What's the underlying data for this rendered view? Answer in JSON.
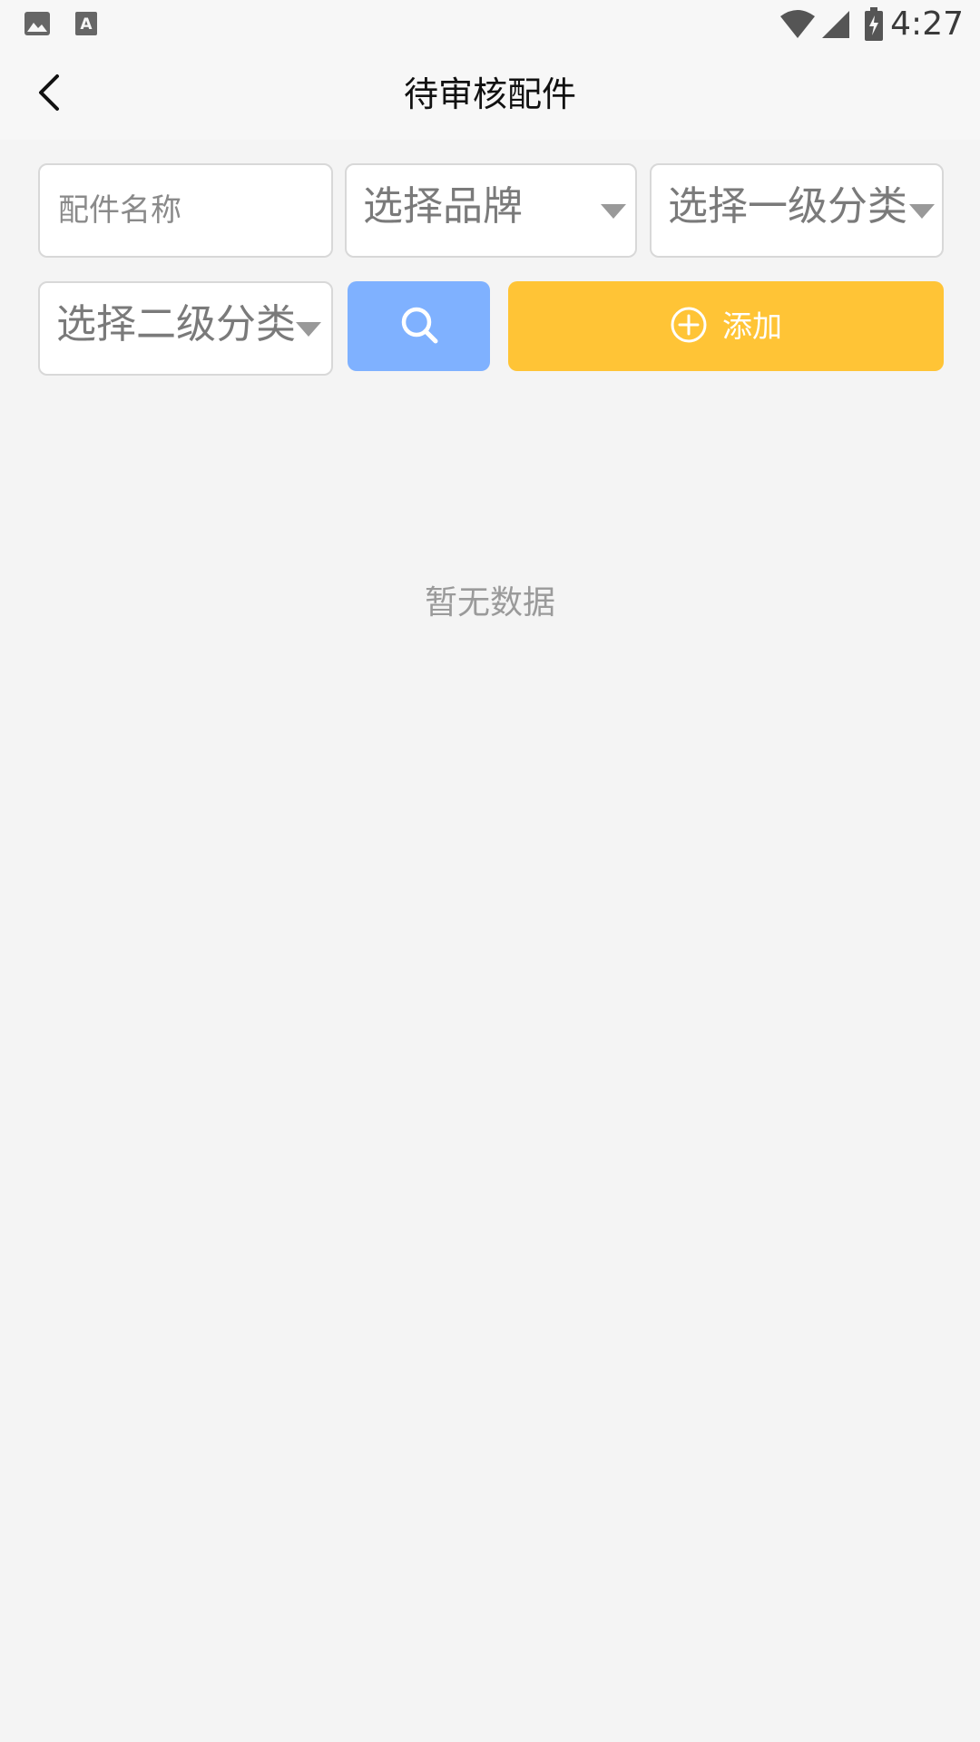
{
  "status_bar": {
    "time": "4:27",
    "icons": [
      "image-icon",
      "text-a-icon",
      "wifi-icon",
      "cell-signal-icon",
      "battery-charging-icon"
    ]
  },
  "header": {
    "title": "待审核配件",
    "back_icon": "chevron-left-icon"
  },
  "filters": {
    "part_name": {
      "placeholder": "配件名称",
      "value": ""
    },
    "brand": {
      "selected": "选择品牌"
    },
    "category_level1": {
      "selected": "选择一级分类"
    },
    "category_level2": {
      "selected": "选择二级分类"
    }
  },
  "actions": {
    "search_icon": "search-icon",
    "add_label": "添加",
    "add_icon": "plus-circle-icon"
  },
  "main": {
    "empty_message": "暂无数据"
  },
  "colors": {
    "page_bg": "#f4f4f4",
    "bar_bg": "#f7f7f7",
    "search_button": "#7fb1ff",
    "add_button": "#ffc436",
    "placeholder_text": "#8a8a8a",
    "empty_text": "#9a9a9a"
  }
}
